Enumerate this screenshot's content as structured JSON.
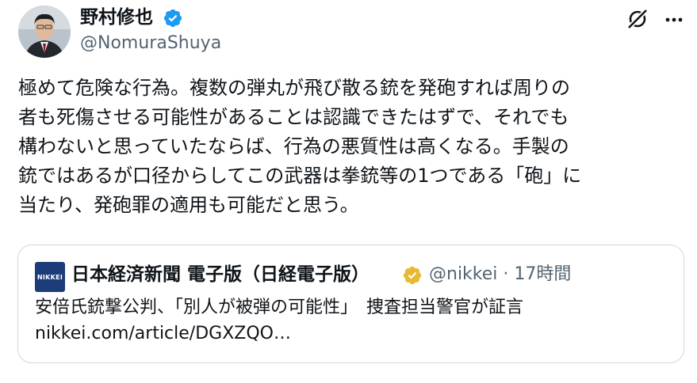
{
  "tweet": {
    "author": {
      "name": "野村修也",
      "handle": "@NomuraShuya",
      "verified": true,
      "verified_color": "#1d9bf0"
    },
    "text_lines": [
      "極めて危険な行為。複数の弾丸が飛び散る銃を発砲すれば周りの",
      "者も死傷させる可能性があることは認識できたはずで、それでも",
      "構わないと思っていたならば、行為の悪質性は高くなる。手製の",
      "銃ではあるが口径からしてこの武器は拳銃等の1つである「砲」に",
      "当たり、発砲罪の適用も可能だと思う。"
    ],
    "actions": {
      "grok_icon": "grok-icon",
      "more_icon": "more-dots-icon"
    }
  },
  "quote": {
    "logo_text": "NIKKEI",
    "logo_color": "#1c3c7a",
    "author_name": "日本経済新聞 電子版（日経電子版）",
    "verified_badge_color": "#e8b931",
    "handle": "@nikkei",
    "separator": "·",
    "time": "17時間",
    "text": "安倍氏銃撃公判、「別人が被弾の可能性」　捜査担当警官が証言",
    "link": "nikkei.com/article/DGXZQO…"
  },
  "colors": {
    "text": "#0f1419",
    "secondary": "#536471",
    "border": "#cfd9de"
  }
}
